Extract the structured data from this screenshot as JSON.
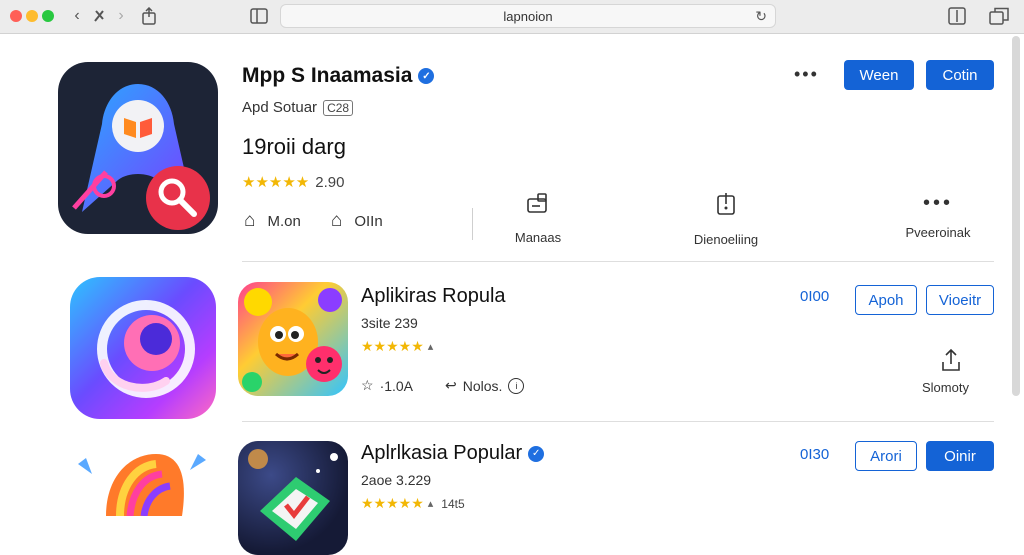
{
  "browser": {
    "url": "lapnoion",
    "colors": {
      "close": "#ff5f57",
      "minimize": "#febc2e",
      "zoom": "#28c840"
    },
    "icons": [
      "back-icon",
      "forward-icon",
      "share-icon",
      "sidebar-icon",
      "reload-icon",
      "tabs-icon"
    ]
  },
  "featured": {
    "title": "Mpp S Inaamasia",
    "developer": "Apd Sotuar",
    "age_badge": "C28",
    "size": "19roii darg",
    "stars": "★★★★★",
    "rating": "2.90",
    "stat_1_value": "M.on",
    "stat_2_value": "OIIn",
    "action_manage": "Manaas",
    "action_download": "Dienoeliing",
    "action_more": "Pveeroinak",
    "more_label": "•••",
    "btn_new": "Ween",
    "btn_get": "Cotin"
  },
  "rows": [
    {
      "title": "Aplikiras Ropula",
      "subtitle": "3site 239",
      "stars": "★★★★★",
      "meta_1": "·1.0A",
      "meta_2": "Nolos.",
      "count": "0I00",
      "btn_1": "Apoh",
      "btn_2": "Vioeitr",
      "share_label": "Slomoty"
    },
    {
      "title": "Aplrlkasia Popular",
      "subtitle": "2aoe 3.229",
      "stars": "★★★★★",
      "meta_1": "14t5",
      "count": "0I30",
      "btn_1": "Arori",
      "btn_2": "Oinir"
    }
  ],
  "accent": "#1463d6"
}
